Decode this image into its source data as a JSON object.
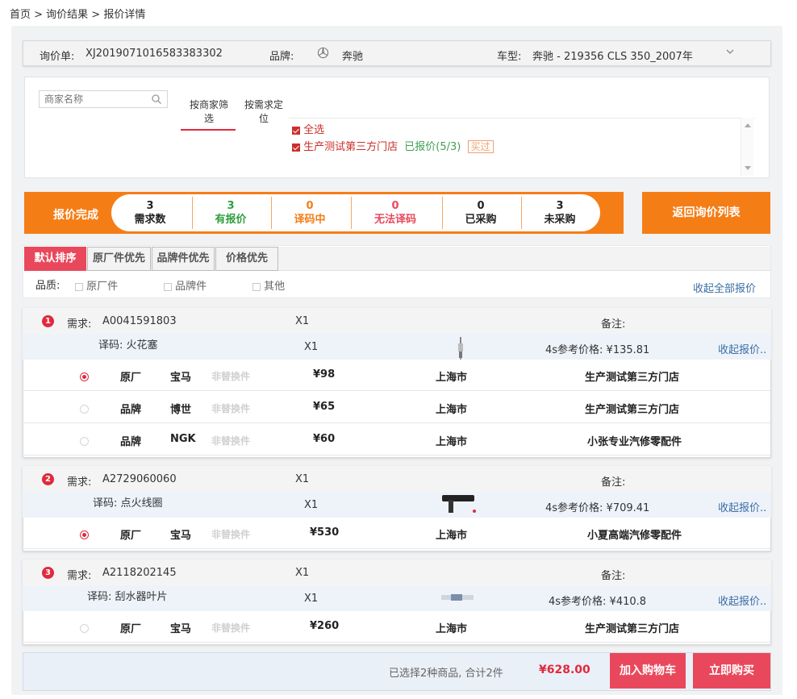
{
  "breadcrumb": "首页 > 询价结果 > 报价详情",
  "inquiry": {
    "order_label": "询价单:",
    "order_no": "XJ2019071016583383302",
    "brand_label": "品牌:",
    "brand": "奔驰",
    "model_label": "车型:",
    "model": "奔驰 - 219356 CLS 350_2007年"
  },
  "filter": {
    "search_placeholder": "商家名称",
    "tab_by_store_line1": "按商家筛",
    "tab_by_store_line2": "选",
    "tab_by_need_line1": "按需求定",
    "tab_by_need_line2": "位",
    "select_all": "全选",
    "store_name": "生产测试第三方门店",
    "store_status": "已报价(5/3)",
    "store_tag": "买过"
  },
  "status": {
    "title": "报价完成",
    "stats": [
      {
        "value": "3",
        "label": "需求数",
        "color": "#222222"
      },
      {
        "value": "3",
        "label": "有报价",
        "color": "#2e9e3e"
      },
      {
        "value": "0",
        "label": "译码中",
        "color": "#f57d16"
      },
      {
        "value": "0",
        "label": "无法译码",
        "color": "#e9485c"
      },
      {
        "value": "0",
        "label": "已采购",
        "color": "#222222"
      },
      {
        "value": "3",
        "label": "未采购",
        "color": "#222222"
      }
    ],
    "return_button": "返回询价列表"
  },
  "sort": {
    "buttons": [
      "默认排序",
      "原厂件优先",
      "品牌件优先",
      "价格优先"
    ],
    "quality_label": "品质:",
    "quality_options": [
      "原厂件",
      "品牌件",
      "其他"
    ],
    "collapse_all": "收起全部报价^"
  },
  "requirements": [
    {
      "index": "1",
      "req_label": "需求:",
      "part_no": "A0041591803",
      "qty": "X1",
      "remark_label": "备注:",
      "decode": "译码: 火花塞",
      "qty2": "X1",
      "ref_price": "4s参考价格: ¥135.81",
      "collapse": "收起报价..",
      "offers": [
        {
          "selected": true,
          "type": "原厂",
          "brand": "宝马",
          "replace": "非替换件",
          "price": "¥98",
          "city": "上海市",
          "store": "生产测试第三方门店"
        },
        {
          "selected": false,
          "type": "品牌",
          "brand": "博世",
          "replace": "非替换件",
          "price": "¥65",
          "city": "上海市",
          "store": "生产测试第三方门店"
        },
        {
          "selected": false,
          "type": "品牌",
          "brand": "NGK",
          "replace": "非替换件",
          "price": "¥60",
          "city": "上海市",
          "store": "小张专业汽修零配件"
        }
      ]
    },
    {
      "index": "2",
      "req_label": "需求:",
      "part_no": "A2729060060",
      "qty": "X1",
      "remark_label": "备注:",
      "decode": "译码: 点火线圈",
      "qty2": "X1",
      "ref_price": "4s参考价格: ¥709.41",
      "collapse": "收起报价..",
      "offers": [
        {
          "selected": true,
          "type": "原厂",
          "brand": "宝马",
          "replace": "非替换件",
          "price": "¥530",
          "city": "上海市",
          "store": "小夏高端汽修零配件"
        }
      ]
    },
    {
      "index": "3",
      "req_label": "需求:",
      "part_no": "A2118202145",
      "qty": "X1",
      "remark_label": "备注:",
      "decode": "译码: 刮水器叶片",
      "qty2": "X1",
      "ref_price": "4s参考价格: ¥410.8",
      "collapse": "收起报价..",
      "offers": [
        {
          "selected": false,
          "type": "原厂",
          "brand": "宝马",
          "replace": "非替换件",
          "price": "¥260",
          "city": "上海市",
          "store": "生产测试第三方门店"
        }
      ]
    }
  ],
  "footer": {
    "summary": "已选择2种商品, 合计2件",
    "total": "¥628.00",
    "add_cart": "加入购物车",
    "buy_now": "立即购买"
  }
}
